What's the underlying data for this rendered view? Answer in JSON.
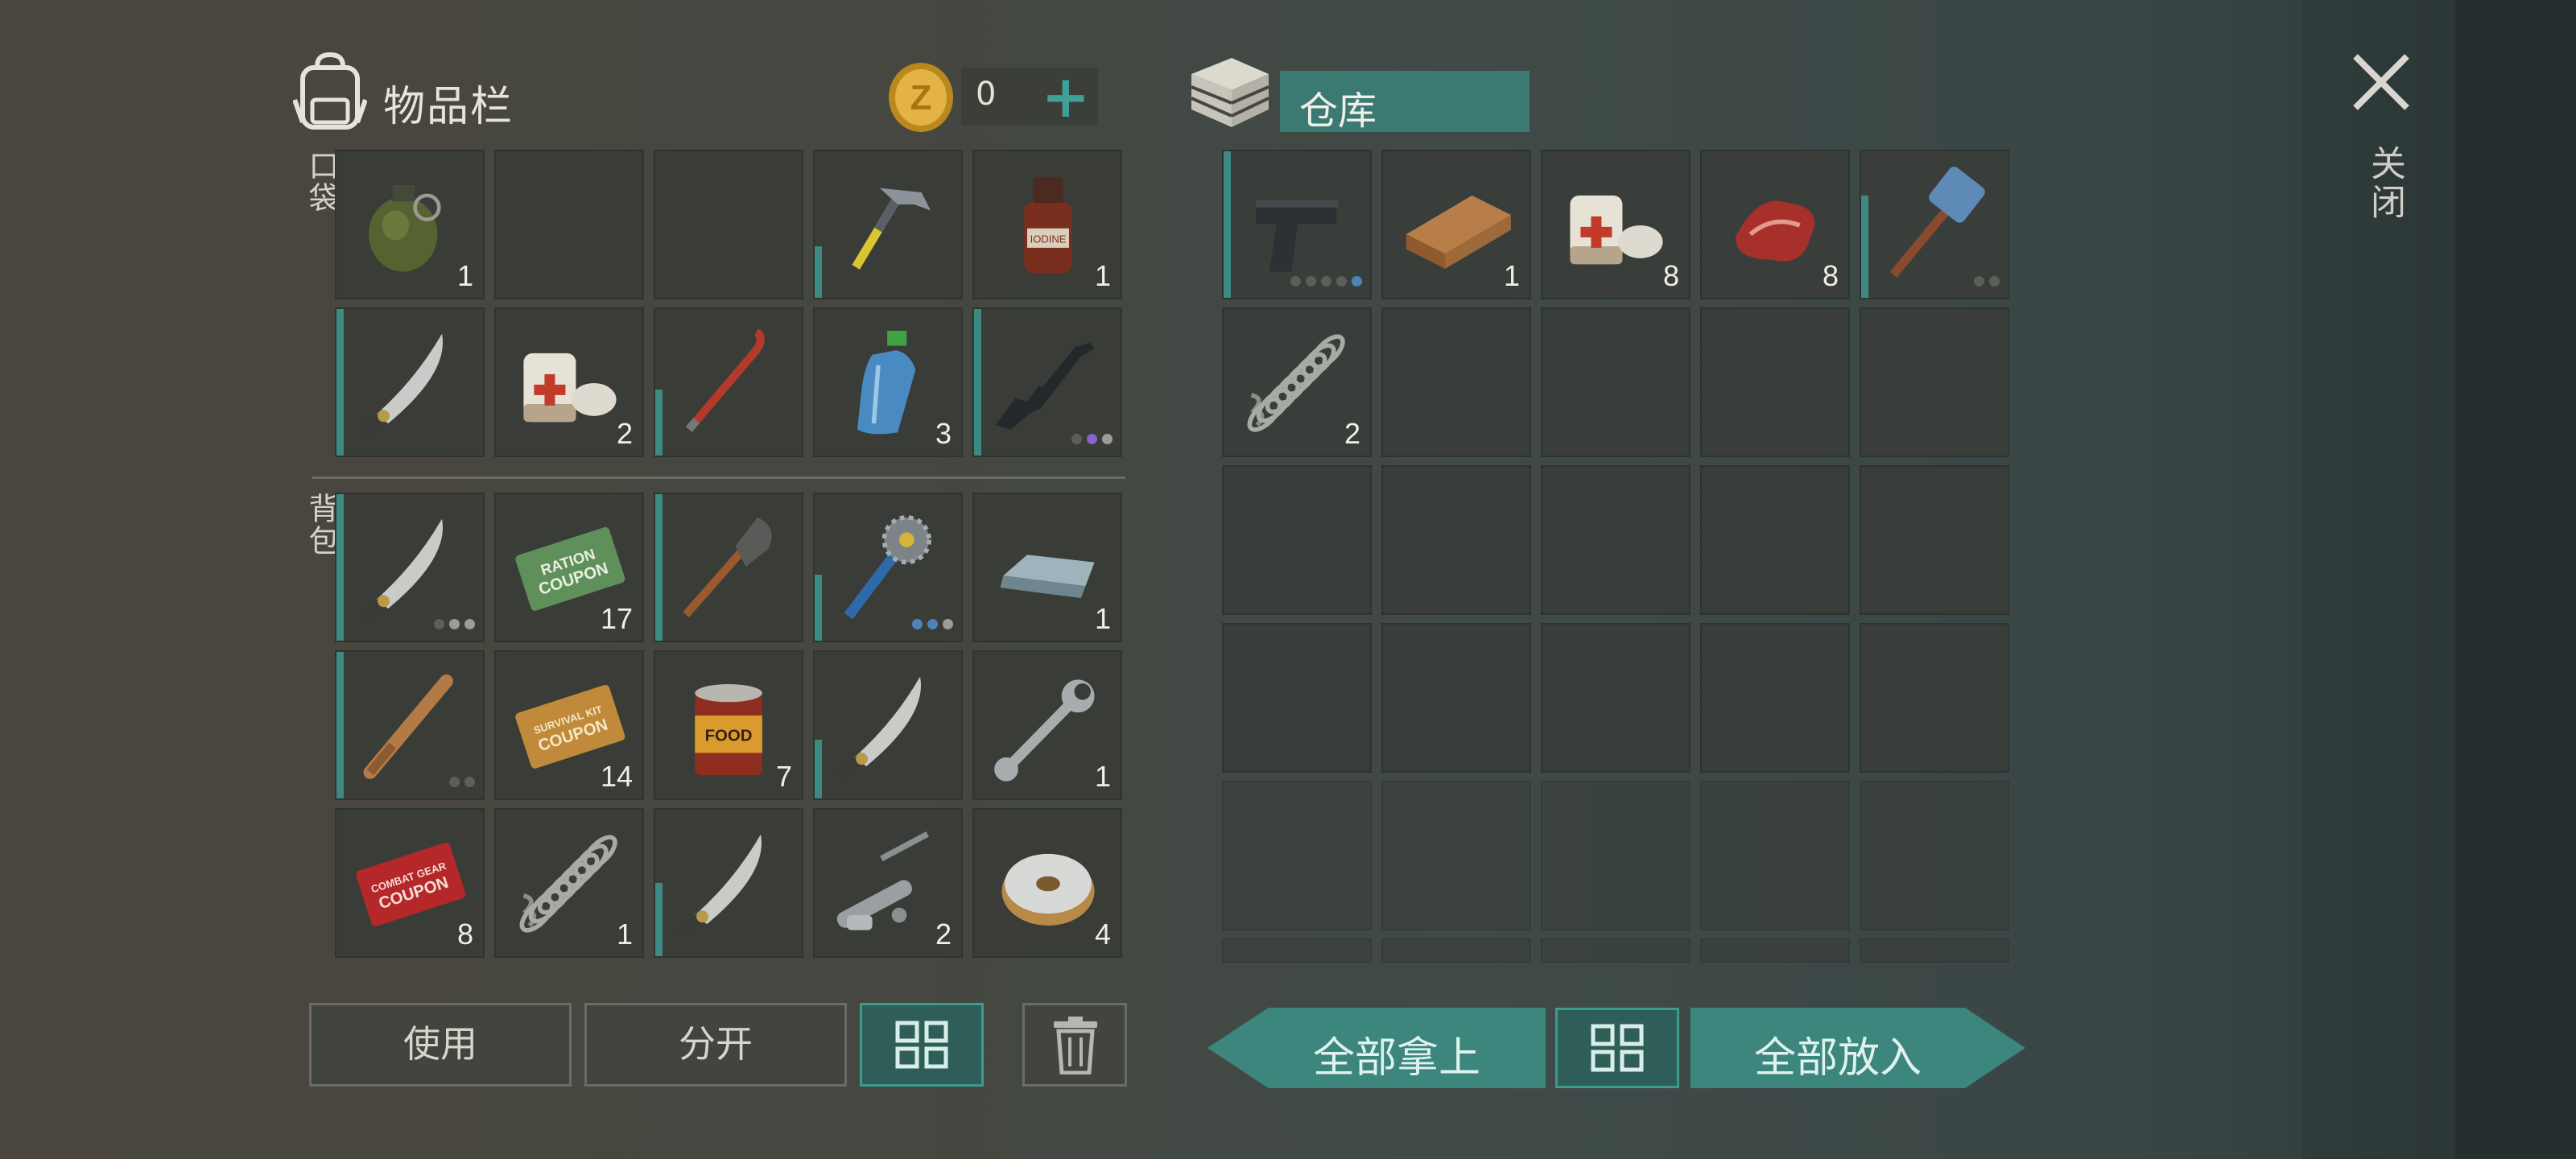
{
  "inventory": {
    "title": "物品栏",
    "coins": "0",
    "add_symbol": "+",
    "pocket_label": "口袋",
    "backpack_label": "背包",
    "pocket": [
      {
        "item": "grenade-icon",
        "count": "1"
      },
      {
        "item": "",
        "count": ""
      },
      {
        "item": "",
        "count": ""
      },
      {
        "item": "hammer-icon",
        "count": "",
        "accent": 0.35
      },
      {
        "item": "bottle-icon",
        "count": "1"
      },
      {
        "item": "machete-icon",
        "count": "",
        "accent": 1.0
      },
      {
        "item": "bandage-icon",
        "count": "2"
      },
      {
        "item": "crowbar-icon",
        "count": "",
        "accent": 0.45
      },
      {
        "item": "water-bottle-icon",
        "count": "3"
      },
      {
        "item": "rifle-icon",
        "count": "",
        "accent": 1.0,
        "dots": [
          "#5b5e59",
          "#8a62c8",
          "#9a9d98"
        ]
      }
    ],
    "backpack": [
      {
        "item": "machete-icon",
        "count": "",
        "accent": 1.0,
        "dots": [
          "#5b5e59",
          "#9a9d98",
          "#9a9d98"
        ]
      },
      {
        "item": "ration-coupon-icon",
        "count": "17"
      },
      {
        "item": "shovel-icon",
        "count": "",
        "accent": 1.0
      },
      {
        "item": "saw-club-icon",
        "count": "",
        "accent": 0.45,
        "dots": [
          "#4d84b8",
          "#4d84b8",
          "#9a9d98"
        ]
      },
      {
        "item": "metal-ingot-icon",
        "count": "1"
      },
      {
        "item": "baseball-bat-icon",
        "count": "",
        "accent": 1.0,
        "dots": [
          "#5b5e59",
          "#5b5e59"
        ]
      },
      {
        "item": "survival-kit-coupon-icon",
        "count": "14"
      },
      {
        "item": "canned-food-icon",
        "count": "7"
      },
      {
        "item": "machete-icon",
        "count": "",
        "accent": 0.4
      },
      {
        "item": "wrench-icon",
        "count": "1"
      },
      {
        "item": "combat-gear-coupon-icon",
        "count": "8"
      },
      {
        "item": "spring-icon",
        "count": "1"
      },
      {
        "item": "machete-icon",
        "count": "",
        "accent": 0.5
      },
      {
        "item": "pipe-parts-icon",
        "count": "2"
      },
      {
        "item": "wire-spool-icon",
        "count": "4"
      }
    ],
    "coupon_texts": {
      "ration": [
        "RATION",
        "COUPON"
      ],
      "survival": [
        "SURVIVAL KIT",
        "COUPON"
      ],
      "combat": [
        "COMBAT GEAR",
        "COUPON"
      ],
      "food": "FOOD",
      "bottle": "IODINE"
    }
  },
  "warehouse": {
    "title": "仓库",
    "slots": [
      {
        "item": "pistol-icon",
        "count": "",
        "accent": 1.0,
        "dots": [
          "#5b5e59",
          "#5b5e59",
          "#5b5e59",
          "#5b5e59",
          "#4d84b8"
        ]
      },
      {
        "item": "wood-plank-icon",
        "count": "1"
      },
      {
        "item": "bandage-icon",
        "count": "8"
      },
      {
        "item": "raw-meat-icon",
        "count": "8"
      },
      {
        "item": "sledgehammer-icon",
        "count": "",
        "accent": 0.7,
        "dots": [
          "#5b5e59",
          "#5b5e59"
        ]
      },
      {
        "item": "spring-icon",
        "count": "2"
      }
    ]
  },
  "buttons": {
    "use": "使用",
    "split": "分开",
    "take_all": "全部拿上",
    "put_all": "全部放入"
  },
  "close_label": "关闭",
  "colors": {
    "accent": "#3c867e",
    "coin": "#d9a93a",
    "panel": "#393c37"
  }
}
